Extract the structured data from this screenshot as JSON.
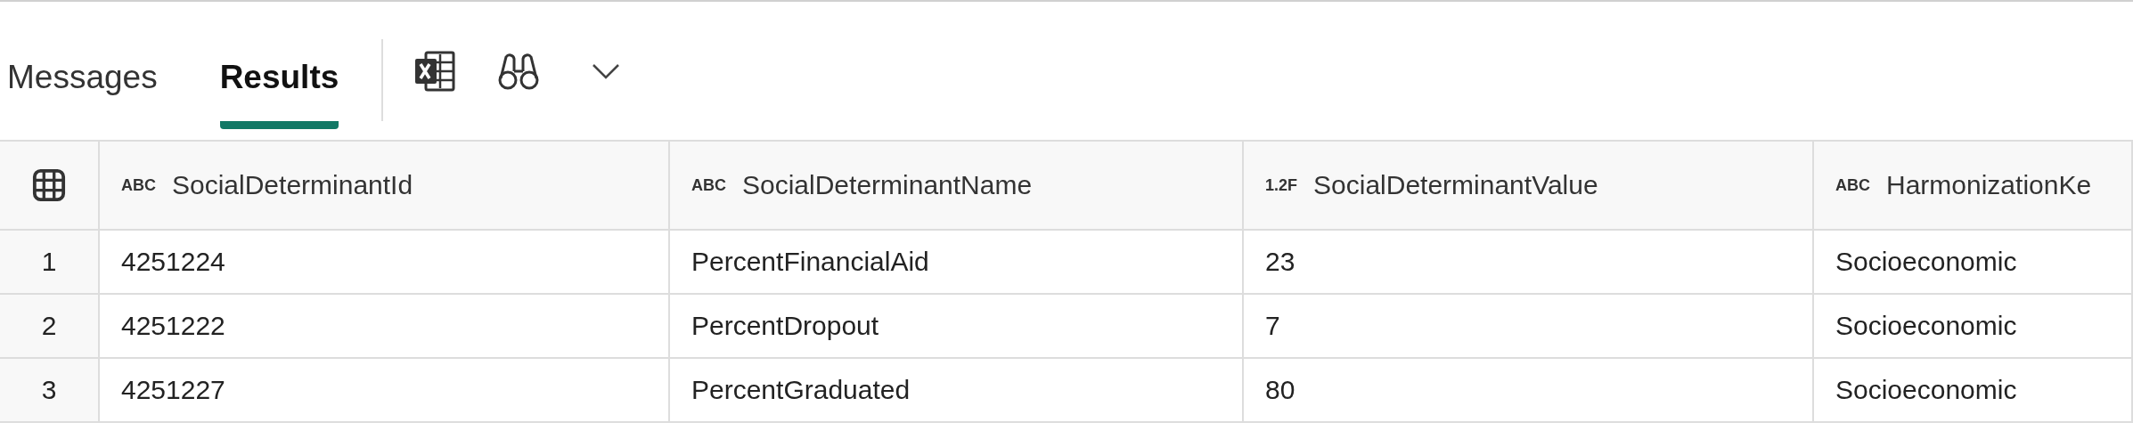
{
  "tabs": [
    {
      "label": "Messages",
      "selected": false
    },
    {
      "label": "Results",
      "selected": true
    }
  ],
  "table": {
    "columns": [
      {
        "type": "ABC",
        "name": "SocialDeterminantId"
      },
      {
        "type": "ABC",
        "name": "SocialDeterminantName"
      },
      {
        "type": "1.2F",
        "name": "SocialDeterminantValue"
      },
      {
        "type": "ABC",
        "name": "HarmonizationKe"
      }
    ],
    "rows": [
      {
        "number": "1",
        "cells": [
          "4251224",
          "PercentFinancialAid",
          "23",
          "Socioeconomic"
        ]
      },
      {
        "number": "2",
        "cells": [
          "4251222",
          "PercentDropout",
          "7",
          "Socioeconomic"
        ]
      },
      {
        "number": "3",
        "cells": [
          "4251227",
          "PercentGraduated",
          "80",
          "Socioeconomic"
        ]
      }
    ]
  }
}
